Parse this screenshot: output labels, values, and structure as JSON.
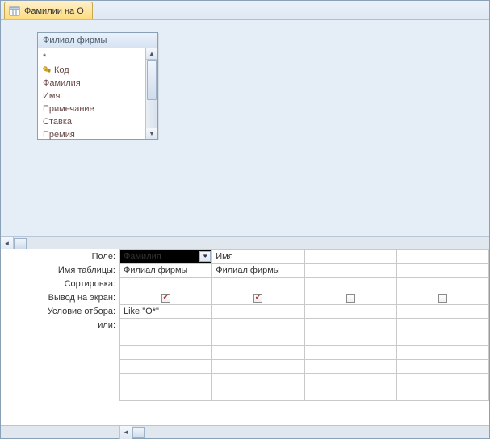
{
  "tab": {
    "title": "Фамилии на О"
  },
  "table_card": {
    "title": "Филиал фирмы",
    "fields": [
      {
        "label": "*",
        "is_star": true,
        "is_key": false
      },
      {
        "label": "Код",
        "is_star": false,
        "is_key": true
      },
      {
        "label": "Фамилия",
        "is_star": false,
        "is_key": false
      },
      {
        "label": "Имя",
        "is_star": false,
        "is_key": false
      },
      {
        "label": "Примечание",
        "is_star": false,
        "is_key": false
      },
      {
        "label": "Ставка",
        "is_star": false,
        "is_key": false
      },
      {
        "label": "Премия",
        "is_star": false,
        "is_key": false
      }
    ]
  },
  "qbe": {
    "row_labels": {
      "field": "Поле:",
      "table": "Имя таблицы:",
      "sort": "Сортировка:",
      "show": "Вывод на экран:",
      "criteria": "Условие отбора:",
      "or": "или:"
    },
    "columns": [
      {
        "field": "Фамилия",
        "table": "Филиал фирмы",
        "sort": "",
        "show": true,
        "criteria": "Like \"О*\"",
        "selected": true
      },
      {
        "field": "Имя",
        "table": "Филиал фирмы",
        "sort": "",
        "show": true,
        "criteria": "",
        "selected": false
      },
      {
        "field": "",
        "table": "",
        "sort": "",
        "show": false,
        "criteria": "",
        "selected": false
      },
      {
        "field": "",
        "table": "",
        "sort": "",
        "show": false,
        "criteria": "",
        "selected": false
      }
    ]
  }
}
